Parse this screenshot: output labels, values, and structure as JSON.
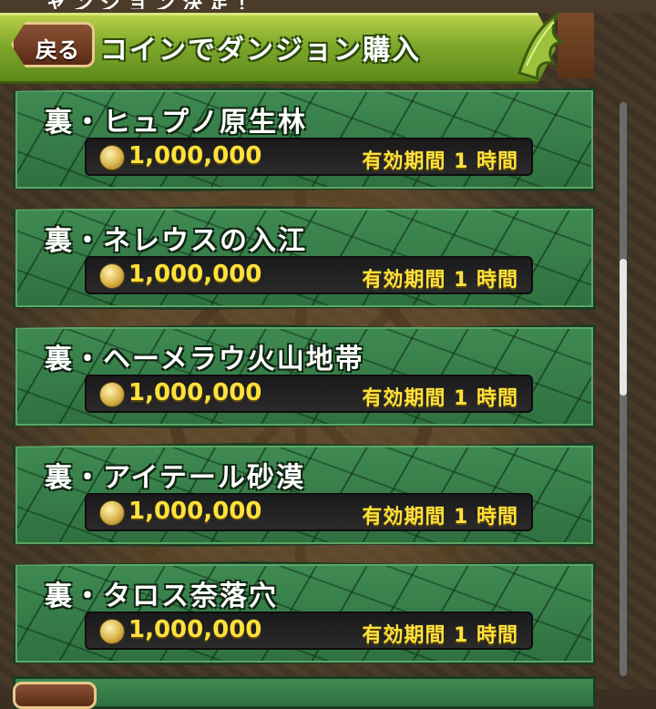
{
  "header": {
    "back_label": "戻る",
    "title": "コインでダンジョン購入",
    "top_cut_text": "ャンジョン決定！"
  },
  "dungeons": [
    {
      "title": "裏・ヒュプノ原生林",
      "price": "1,000,000",
      "expiry": "有効期間 1 時間"
    },
    {
      "title": "裏・ネレウスの入江",
      "price": "1,000,000",
      "expiry": "有効期間 1 時間"
    },
    {
      "title": "裏・ヘーメラウ火山地帯",
      "price": "1,000,000",
      "expiry": "有効期間 1 時間"
    },
    {
      "title": "裏・アイテール砂漠",
      "price": "1,000,000",
      "expiry": "有効期間 1 時間"
    },
    {
      "title": "裏・タロス奈落穴",
      "price": "1,000,000",
      "expiry": "有効期間 1 時間"
    }
  ],
  "icons": {
    "coin": "coin-icon",
    "dragon": "dragon-wing-icon"
  },
  "colors": {
    "header_green": "#7fa82a",
    "card_green": "#2f7040",
    "price_yellow": "#ffe13a"
  }
}
